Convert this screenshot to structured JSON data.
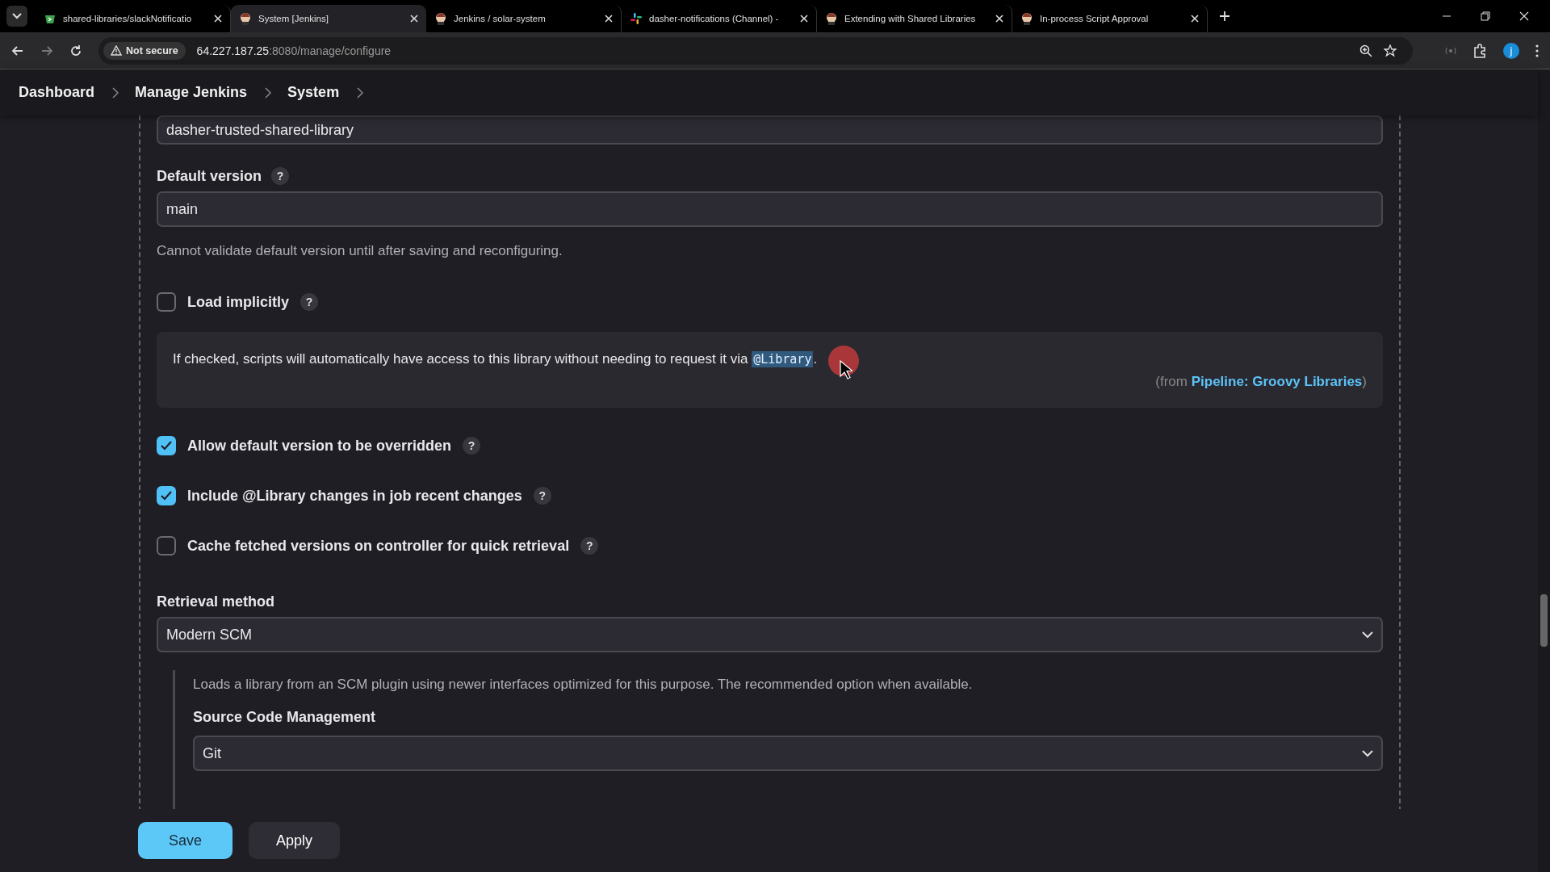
{
  "browser": {
    "tabs": [
      {
        "title": "shared-libraries/slackNotificatio",
        "kind": "repo",
        "selected": false
      },
      {
        "title": "System [Jenkins]",
        "kind": "jenkins",
        "selected": true
      },
      {
        "title": "Jenkins / solar-system",
        "kind": "jenkins",
        "selected": false
      },
      {
        "title": "dasher-notifications (Channel) -",
        "kind": "slack",
        "selected": false
      },
      {
        "title": "Extending with Shared Libraries",
        "kind": "jenkins",
        "selected": false
      },
      {
        "title": "In-process Script Approval",
        "kind": "jenkins",
        "selected": false
      }
    ],
    "security_chip": "Not secure",
    "url_host": "64.227.187.25",
    "url_rest": ":8080/manage/configure",
    "profile_initial": "j"
  },
  "breadcrumbs": [
    "Dashboard",
    "Manage Jenkins",
    "System"
  ],
  "library_name": {
    "value": "dasher-trusted-shared-library"
  },
  "default_version": {
    "label": "Default version",
    "help": "?",
    "value": "main",
    "hint": "Cannot validate default version until after saving and reconfiguring."
  },
  "options": [
    {
      "label": "Load implicitly",
      "help": "?",
      "checked": false
    },
    {
      "label": "Allow default version to be overridden",
      "help": "?",
      "checked": true
    },
    {
      "label": "Include @Library changes in job recent changes",
      "help": "?",
      "checked": true
    },
    {
      "label": "Cache fetched versions on controller for quick retrieval",
      "help": "?",
      "checked": false
    }
  ],
  "help_box": {
    "text": "If checked, scripts will automatically have access to this library without needing to request it via",
    "code": "@Library",
    "after": ".",
    "source_prefix": "(from",
    "source_link": "Pipeline: Groovy Libraries",
    "source_suffix": ")"
  },
  "retrieval": {
    "label": "Retrieval method",
    "value": "Modern SCM",
    "description": "Loads a library from an SCM plugin using newer interfaces optimized for this purpose. The recommended option when available.",
    "scm_label": "Source Code Management",
    "scm_value": "Git"
  },
  "buttons": [
    {
      "label": "Save",
      "kind": "primary"
    },
    {
      "label": "Apply",
      "kind": "secondary"
    }
  ]
}
